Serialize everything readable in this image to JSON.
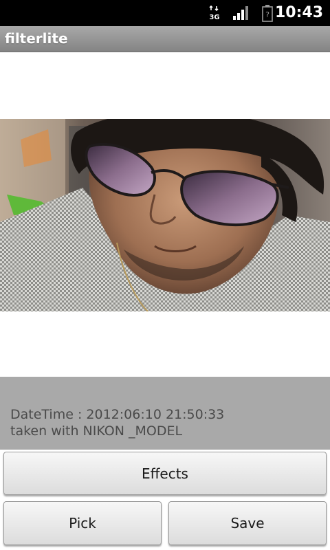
{
  "status_bar": {
    "time": "10:43",
    "network_label": "3G",
    "icons": [
      "network-3g-icon",
      "signal-strength-icon",
      "battery-unknown-icon"
    ],
    "battery_label": "?"
  },
  "app": {
    "title": "filterlite"
  },
  "photo": {
    "subject": "photo-preview"
  },
  "info": {
    "datetime": "DateTime : 2012:06:10 21:50:33",
    "camera": "taken with NIKON _MODEL"
  },
  "buttons": {
    "effects": "Effects",
    "pick": "Pick",
    "save": "Save"
  },
  "colors": {
    "status_bar_bg": "#000000",
    "title_bar_bg": "#959595",
    "info_panel_bg": "#a9a9a9",
    "button_bg": "#e9e9e9"
  }
}
